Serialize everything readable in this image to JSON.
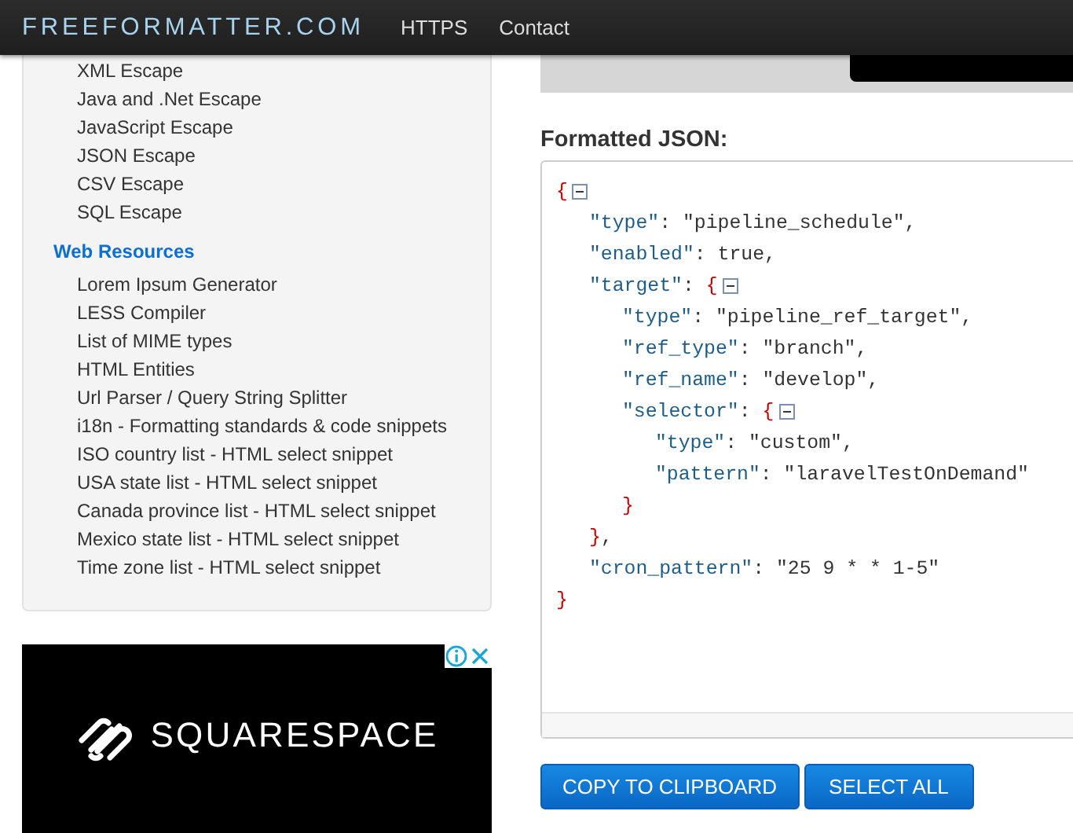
{
  "header": {
    "logo": "FREEFORMATTER.COM",
    "nav": [
      "HTTPS",
      "Contact"
    ]
  },
  "sidebar": {
    "items_top": [
      "XML Escape",
      "Java and .Net Escape",
      "JavaScript Escape",
      "JSON Escape",
      "CSV Escape",
      "SQL Escape"
    ],
    "section": {
      "heading": "Web Resources",
      "items": [
        "Lorem Ipsum Generator",
        "LESS Compiler",
        "List of MIME types",
        "HTML Entities",
        "Url Parser / Query String Splitter",
        "i18n - Formatting standards & code snippets",
        "ISO country list - HTML select snippet",
        "USA state list - HTML select snippet",
        "Canada province list - HTML select snippet",
        "Mexico state list - HTML select snippet",
        "Time zone list - HTML select snippet"
      ]
    }
  },
  "ad": {
    "brand": "SQUARESPACE"
  },
  "output": {
    "title": "Formatted JSON:",
    "code": {
      "open": "{",
      "close": "}",
      "members": [
        {
          "kind": "value",
          "key": "\"type\"",
          "colon": ":",
          "value": "\"pipeline_schedule\"",
          "comma": ","
        },
        {
          "kind": "value",
          "key": "\"enabled\"",
          "colon": ":",
          "value": "true",
          "comma": ","
        },
        {
          "kind": "object",
          "key": "\"target\"",
          "colon": ":",
          "open": "{",
          "close": "}",
          "comma": ",",
          "members": [
            {
              "kind": "value",
              "key": "\"type\"",
              "colon": ":",
              "value": "\"pipeline_ref_target\"",
              "comma": ","
            },
            {
              "kind": "value",
              "key": "\"ref_type\"",
              "colon": ":",
              "value": "\"branch\"",
              "comma": ","
            },
            {
              "kind": "value",
              "key": "\"ref_name\"",
              "colon": ":",
              "value": "\"develop\"",
              "comma": ","
            },
            {
              "kind": "object",
              "key": "\"selector\"",
              "colon": ":",
              "open": "{",
              "close": "}",
              "members": [
                {
                  "kind": "value",
                  "key": "\"type\"",
                  "colon": ":",
                  "value": "\"custom\"",
                  "comma": ","
                },
                {
                  "kind": "value",
                  "key": "\"pattern\"",
                  "colon": ":",
                  "value": "\"laravelTestOnDemand\""
                }
              ]
            }
          ]
        },
        {
          "kind": "value",
          "key": "\"cron_pattern\"",
          "colon": ":",
          "value": "\"25 9 * * 1-5\""
        }
      ]
    },
    "buttons": [
      "COPY TO CLIPBOARD",
      "SELECT ALL"
    ]
  }
}
